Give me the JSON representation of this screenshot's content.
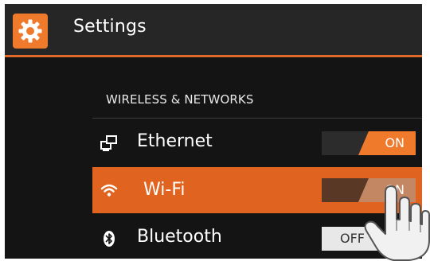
{
  "header": {
    "title": "Settings",
    "icon": "gear-icon"
  },
  "section": {
    "title": "WIRELESS & NETWORKS"
  },
  "items": [
    {
      "label": "Ethernet",
      "icon": "ethernet-icon",
      "toggle": "ON",
      "state": true
    },
    {
      "label": "Wi-Fi",
      "icon": "wifi-icon",
      "toggle": "ON",
      "state": true,
      "selected": true
    },
    {
      "label": "Bluetooth",
      "icon": "bluetooth-icon",
      "toggle": "OFF",
      "state": false
    }
  ],
  "colors": {
    "accent": "#f07a2c",
    "selected_row": "#e0641f",
    "background": "#141414"
  }
}
